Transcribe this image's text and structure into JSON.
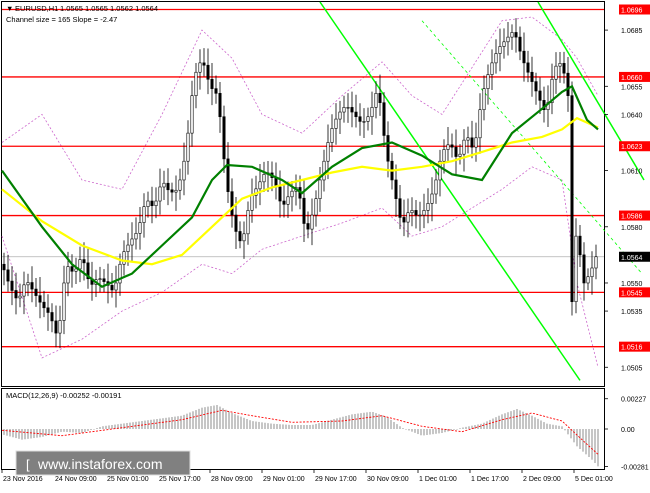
{
  "header": {
    "symbol": "EURUSD,H1",
    "ohlc": "1.0565 1.0565 1.0562 1.0564",
    "channel_info": "Channel size = 165 Slope = -2.47"
  },
  "watermark": "www.instaforex.com",
  "colors": {
    "level_line": "#ff0000",
    "level_tag_bg": "#ff0000",
    "price_tag_bg": "#c0c0c0",
    "trend_line": "#00ff00",
    "ma_fast": "#008000",
    "ma_slow": "#ffff00",
    "bollinger": "#cc66cc",
    "macd_hist": "#c0c0c0",
    "macd_signal": "#ff0000",
    "candle": "#000000"
  },
  "chart_data": [
    {
      "type": "candlestick",
      "symbol": "EURUSD",
      "timeframe": "H1",
      "ylim": [
        1.0495,
        1.07
      ],
      "y_ticks": [
        "1.0685",
        "1.0655",
        "1.0640",
        "1.0610",
        "1.0580",
        "1.0550",
        "1.0535",
        "1.0505"
      ],
      "x_labels": [
        "23 Nov 2016",
        "24 Nov 09:00",
        "25 Nov 01:00",
        "25 Nov 17:00",
        "28 Nov 09:00",
        "29 Nov 01:00",
        "29 Nov 17:00",
        "30 Nov 09:00",
        "1 Dec 01:00",
        "1 Dec 17:00",
        "2 Dec 09:00",
        "5 Dec 01:00"
      ],
      "levels": [
        {
          "label": "1.0696",
          "value": 1.0696
        },
        {
          "label": "1.0660",
          "value": 1.066
        },
        {
          "label": "1.0623",
          "value": 1.0623
        },
        {
          "label": "1.0586",
          "value": 1.0586
        },
        {
          "label": "1.0545",
          "value": 1.0545
        },
        {
          "label": "1.0516",
          "value": 1.0516
        }
      ],
      "current_price": {
        "label": "1.0564",
        "value": 1.0564
      },
      "close_path": [
        [
          0,
          1.056
        ],
        [
          8,
          1.0548
        ],
        [
          16,
          1.054
        ],
        [
          24,
          1.0552
        ],
        [
          32,
          1.0545
        ],
        [
          40,
          1.0538
        ],
        [
          48,
          1.0533
        ],
        [
          56,
          1.052
        ],
        [
          64,
          1.056
        ],
        [
          72,
          1.0555
        ],
        [
          80,
          1.0565
        ],
        [
          88,
          1.0548
        ],
        [
          96,
          1.0553
        ],
        [
          104,
          1.055
        ],
        [
          112,
          1.0545
        ],
        [
          120,
          1.0565
        ],
        [
          128,
          1.0572
        ],
        [
          136,
          1.0578
        ],
        [
          144,
          1.0595
        ],
        [
          152,
          1.059
        ],
        [
          160,
          1.0605
        ],
        [
          168,
          1.0598
        ],
        [
          176,
          1.06
        ],
        [
          184,
          1.062
        ],
        [
          192,
          1.066
        ],
        [
          200,
          1.067
        ],
        [
          208,
          1.0655
        ],
        [
          216,
          1.065
        ],
        [
          224,
          1.0605
        ],
        [
          232,
          1.058
        ],
        [
          240,
          1.057
        ],
        [
          248,
          1.0595
        ],
        [
          256,
          1.0602
        ],
        [
          264,
          1.061
        ],
        [
          272,
          1.0605
        ],
        [
          280,
          1.059
        ],
        [
          288,
          1.0598
        ],
        [
          296,
          1.0602
        ],
        [
          304,
          1.0575
        ],
        [
          312,
          1.059
        ],
        [
          320,
          1.061
        ],
        [
          328,
          1.063
        ],
        [
          336,
          1.064
        ],
        [
          344,
          1.0645
        ],
        [
          352,
          1.064
        ],
        [
          360,
          1.0635
        ],
        [
          368,
          1.064
        ],
        [
          376,
          1.0655
        ],
        [
          384,
          1.062
        ],
        [
          392,
          1.06
        ],
        [
          400,
          1.058
        ],
        [
          408,
          1.059
        ],
        [
          416,
          1.0585
        ],
        [
          424,
          1.059
        ],
        [
          432,
          1.06
        ],
        [
          440,
          1.062
        ],
        [
          448,
          1.0625
        ],
        [
          456,
          1.0615
        ],
        [
          464,
          1.063
        ],
        [
          472,
          1.062
        ],
        [
          480,
          1.065
        ],
        [
          488,
          1.0665
        ],
        [
          496,
          1.0675
        ],
        [
          504,
          1.068
        ],
        [
          512,
          1.0685
        ],
        [
          520,
          1.067
        ],
        [
          528,
          1.066
        ],
        [
          536,
          1.065
        ],
        [
          544,
          1.064
        ],
        [
          552,
          1.0665
        ],
        [
          560,
          1.0668
        ],
        [
          566,
          1.065
        ],
        [
          570,
          1.054
        ],
        [
          574,
          1.0575
        ],
        [
          578,
          1.0565
        ],
        [
          582,
          1.055
        ],
        [
          588,
          1.0555
        ],
        [
          594,
          1.0564
        ]
      ],
      "ma_fast_path": [
        [
          0,
          1.061
        ],
        [
          40,
          1.058
        ],
        [
          70,
          1.056
        ],
        [
          100,
          1.0548
        ],
        [
          130,
          1.0555
        ],
        [
          160,
          1.057
        ],
        [
          190,
          1.0585
        ],
        [
          210,
          1.0605
        ],
        [
          225,
          1.0613
        ],
        [
          250,
          1.0612
        ],
        [
          280,
          1.0605
        ],
        [
          300,
          1.0598
        ],
        [
          330,
          1.0612
        ],
        [
          360,
          1.0622
        ],
        [
          390,
          1.0625
        ],
        [
          420,
          1.0618
        ],
        [
          450,
          1.0608
        ],
        [
          480,
          1.0605
        ],
        [
          510,
          1.063
        ],
        [
          540,
          1.0643
        ],
        [
          560,
          1.0652
        ],
        [
          570,
          1.0655
        ],
        [
          585,
          1.0637
        ],
        [
          596,
          1.0632
        ]
      ],
      "ma_slow_path": [
        [
          0,
          1.06
        ],
        [
          40,
          1.0583
        ],
        [
          80,
          1.057
        ],
        [
          120,
          1.0562
        ],
        [
          150,
          1.056
        ],
        [
          180,
          1.0565
        ],
        [
          210,
          1.058
        ],
        [
          240,
          1.0595
        ],
        [
          270,
          1.0601
        ],
        [
          300,
          1.0605
        ],
        [
          330,
          1.0609
        ],
        [
          360,
          1.0612
        ],
        [
          390,
          1.061
        ],
        [
          420,
          1.0612
        ],
        [
          450,
          1.0615
        ],
        [
          480,
          1.062
        ],
        [
          510,
          1.0625
        ],
        [
          540,
          1.0628
        ],
        [
          560,
          1.0632
        ],
        [
          575,
          1.0638
        ],
        [
          596,
          1.0633
        ]
      ],
      "bollinger_upper_path": [
        [
          0,
          1.0625
        ],
        [
          40,
          1.064
        ],
        [
          80,
          1.0605
        ],
        [
          120,
          1.06
        ],
        [
          160,
          1.064
        ],
        [
          200,
          1.0685
        ],
        [
          230,
          1.067
        ],
        [
          260,
          1.064
        ],
        [
          300,
          1.063
        ],
        [
          340,
          1.065
        ],
        [
          380,
          1.0668
        ],
        [
          410,
          1.065
        ],
        [
          440,
          1.064
        ],
        [
          470,
          1.0665
        ],
        [
          500,
          1.069
        ],
        [
          530,
          1.0692
        ],
        [
          560,
          1.068
        ],
        [
          575,
          1.067
        ],
        [
          596,
          1.065
        ]
      ],
      "bollinger_lower_path": [
        [
          0,
          1.0575
        ],
        [
          40,
          1.051
        ],
        [
          80,
          1.052
        ],
        [
          120,
          1.0535
        ],
        [
          160,
          1.0545
        ],
        [
          200,
          1.056
        ],
        [
          230,
          1.0555
        ],
        [
          260,
          1.0568
        ],
        [
          300,
          1.0575
        ],
        [
          340,
          1.0582
        ],
        [
          380,
          1.059
        ],
        [
          410,
          1.0575
        ],
        [
          440,
          1.058
        ],
        [
          470,
          1.059
        ],
        [
          500,
          1.06
        ],
        [
          530,
          1.0612
        ],
        [
          560,
          1.0605
        ],
        [
          575,
          1.055
        ],
        [
          596,
          1.0505
        ]
      ],
      "trend_lines": [
        {
          "from": [
            318,
            1.07
          ],
          "to": [
            578,
            1.0498
          ]
        },
        {
          "from": [
            536,
            1.07
          ],
          "to": [
            645,
            1.0605
          ]
        }
      ],
      "dashed_trend_lines": [
        {
          "from": [
            420,
            1.069
          ],
          "to": [
            640,
            1.0555
          ]
        }
      ]
    },
    {
      "type": "macd",
      "title": "MACD(12,26,9) -0.00252 -0.00191",
      "ylim": [
        -0.003,
        0.003
      ],
      "y_ticks": [
        "0.00227",
        "0.00",
        "-0.00281"
      ],
      "tick_values": [
        0.00227,
        0.0,
        -0.00281
      ],
      "histogram_path": [
        [
          0,
          -0.0004
        ],
        [
          20,
          -0.0008
        ],
        [
          40,
          -0.0006
        ],
        [
          60,
          -0.0002
        ],
        [
          80,
          -0.0003
        ],
        [
          100,
          0.0002
        ],
        [
          120,
          0.0004
        ],
        [
          140,
          0.0006
        ],
        [
          160,
          0.0008
        ],
        [
          180,
          0.001
        ],
        [
          200,
          0.0016
        ],
        [
          215,
          0.0018
        ],
        [
          230,
          0.0012
        ],
        [
          250,
          0.0006
        ],
        [
          270,
          0.0004
        ],
        [
          290,
          0.0003
        ],
        [
          310,
          0.0003
        ],
        [
          330,
          0.0007
        ],
        [
          350,
          0.0011
        ],
        [
          370,
          0.0013
        ],
        [
          385,
          0.0009
        ],
        [
          400,
          0.0001
        ],
        [
          420,
          -0.0005
        ],
        [
          440,
          -0.0003
        ],
        [
          460,
          0.0001
        ],
        [
          480,
          0.0004
        ],
        [
          500,
          0.0011
        ],
        [
          515,
          0.0015
        ],
        [
          530,
          0.001
        ],
        [
          545,
          0.0004
        ],
        [
          560,
          0.0002
        ],
        [
          575,
          -0.0013
        ],
        [
          590,
          -0.0023
        ],
        [
          596,
          -0.0028
        ]
      ],
      "signal_path": [
        [
          0,
          -0.0001
        ],
        [
          60,
          -0.0005
        ],
        [
          120,
          0.0001
        ],
        [
          180,
          0.0007
        ],
        [
          220,
          0.0014
        ],
        [
          250,
          0.001
        ],
        [
          290,
          0.0005
        ],
        [
          340,
          0.0006
        ],
        [
          380,
          0.001
        ],
        [
          420,
          0.0002
        ],
        [
          460,
          -0.0002
        ],
        [
          500,
          0.0007
        ],
        [
          530,
          0.0012
        ],
        [
          560,
          0.0006
        ],
        [
          580,
          -0.0008
        ],
        [
          596,
          -0.0019
        ]
      ]
    }
  ]
}
